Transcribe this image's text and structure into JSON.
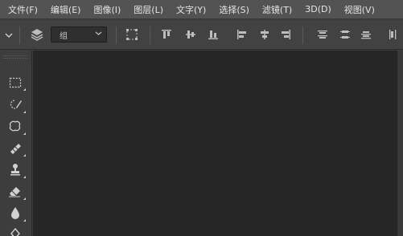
{
  "menubar": {
    "items": [
      {
        "label": "文件(F)"
      },
      {
        "label": "编辑(E)"
      },
      {
        "label": "图像(I)"
      },
      {
        "label": "图层(L)"
      },
      {
        "label": "文字(Y)"
      },
      {
        "label": "选择(S)"
      },
      {
        "label": "滤镜(T)"
      },
      {
        "label": "3D(D)"
      },
      {
        "label": "视图(V)"
      }
    ]
  },
  "options": {
    "layer_select_value": "组"
  },
  "tools": [
    {
      "icon": "rectangular-marquee-icon"
    },
    {
      "icon": "quick-selection-icon"
    },
    {
      "icon": "spot-healing-icon"
    },
    {
      "icon": "brush-icon"
    },
    {
      "icon": "clone-stamp-icon"
    },
    {
      "icon": "eraser-icon"
    },
    {
      "icon": "blur-drop-icon"
    },
    {
      "icon": "pen-icon"
    }
  ],
  "colors": {
    "menubar_bg": "#535353",
    "optionsbar_bg": "#424242",
    "tools_bg": "#3d3d3d",
    "canvas_bg": "#262626"
  }
}
